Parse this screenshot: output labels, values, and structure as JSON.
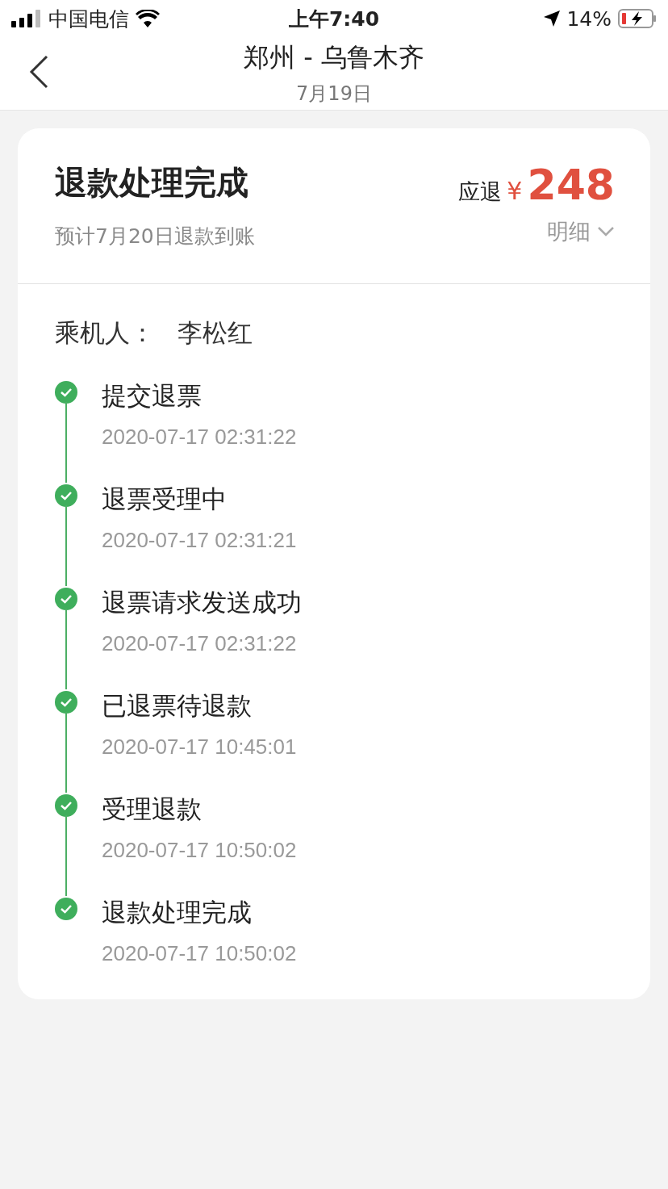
{
  "status_bar": {
    "carrier": "中国电信",
    "time": "上午7:40",
    "battery": "14%"
  },
  "header": {
    "title": "郑州 - 乌鲁木齐",
    "subtitle": "7月19日"
  },
  "refund": {
    "status": "退款处理完成",
    "expected": "预计7月20日退款到账",
    "amount_label": "应退",
    "currency": "¥",
    "amount": "248",
    "details_link": "明细"
  },
  "passenger": {
    "label": "乘机人：",
    "name": "李松红"
  },
  "steps": [
    {
      "title": "提交退票",
      "time": "2020-07-17 02:31:22",
      "done": true
    },
    {
      "title": "退票受理中",
      "time": "2020-07-17 02:31:21",
      "done": true
    },
    {
      "title": "退票请求发送成功",
      "time": "2020-07-17 02:31:22",
      "done": true
    },
    {
      "title": "已退票待退款",
      "time": "2020-07-17 10:45:01",
      "done": true
    },
    {
      "title": "受理退款",
      "time": "2020-07-17 10:50:02",
      "done": true
    },
    {
      "title": "退款处理完成",
      "time": "2020-07-17 10:50:02",
      "done": true
    }
  ]
}
